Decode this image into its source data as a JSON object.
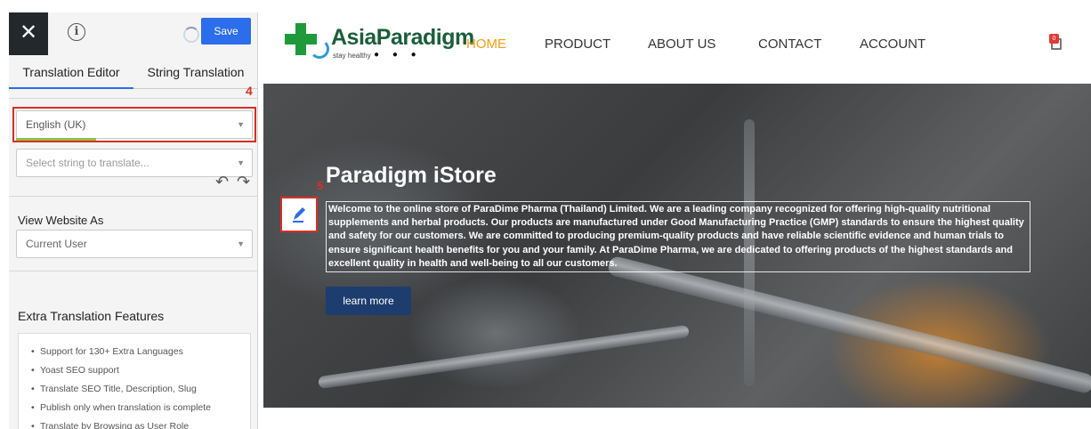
{
  "panel": {
    "close_glyph": "✕",
    "info_glyph": "i",
    "save_label": "Save",
    "tabs": [
      {
        "label": "Translation Editor",
        "active": true
      },
      {
        "label": "String Translation",
        "active": false
      }
    ],
    "marker_4": "4",
    "language_select": {
      "value": "English (UK)"
    },
    "string_select": {
      "placeholder": "Select string to translate..."
    },
    "undo_glyph": "↶",
    "redo_glyph": "↷",
    "view_as": {
      "label": "View Website As",
      "value": "Current User"
    },
    "extra": {
      "title": "Extra Translation Features",
      "items": [
        "Support for 130+ Extra Languages",
        "Yoast SEO support",
        "Translate SEO Title, Description, Slug",
        "Publish only when translation is complete",
        "Translate by Browsing as User Role"
      ]
    }
  },
  "site": {
    "logo": {
      "name": "AsiaParadigm",
      "tagline": "stay healthy",
      "dots": "● ● ●"
    },
    "nav": [
      {
        "label": "HOME",
        "active": true
      },
      {
        "label": "PRODUCT",
        "active": false
      },
      {
        "label": "ABOUT US",
        "active": false
      },
      {
        "label": "CONTACT",
        "active": false
      },
      {
        "label": "ACCOUNT",
        "active": false
      }
    ],
    "cart_count": "0",
    "hero": {
      "title": "Paradigm iStore",
      "description": "Welcome to the online store of ParaDime Pharma (Thailand) Limited. We are a leading company recognized for offering high-quality nutritional supplements and herbal products. Our products are manufactured under Good Manufacturing Practice (GMP) standards to ensure the highest quality and safety for our customers. We are committed to producing premium-quality products and have reliable scientific evidence and human trials to ensure significant health benefits for you and your family. At ParaDime Pharma, we are dedicated to offering products of the highest standards and excellent quality in health and well-being to all our customers.",
      "marker_5": "5",
      "button_label": "learn more"
    }
  },
  "colors": {
    "save_blue": "#2b6dea",
    "highlight_red": "#d93025",
    "nav_active": "#f39c12",
    "logo_green": "#1f9a3a",
    "button_navy": "#1d3d6e"
  }
}
